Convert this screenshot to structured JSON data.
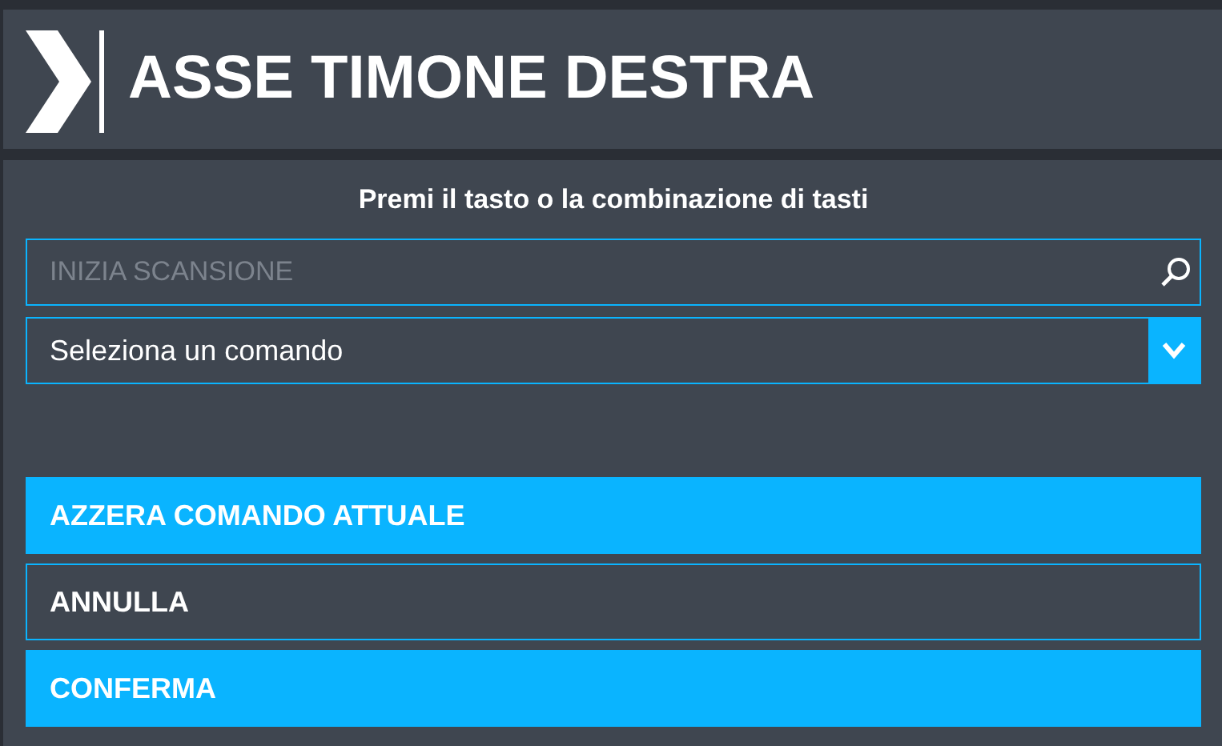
{
  "header": {
    "title": "ASSE TIMONE DESTRA"
  },
  "prompt": "Premi il tasto o la combinazione di tasti",
  "search": {
    "placeholder": "INIZIA SCANSIONE"
  },
  "command_select": {
    "value": "Seleziona un comando"
  },
  "buttons": [
    {
      "label": "AZZERA COMANDO ATTUALE",
      "kind": "filled"
    },
    {
      "label": "ANNULLA",
      "kind": "outline"
    },
    {
      "label": "CONFERMA",
      "kind": "filled"
    }
  ]
}
